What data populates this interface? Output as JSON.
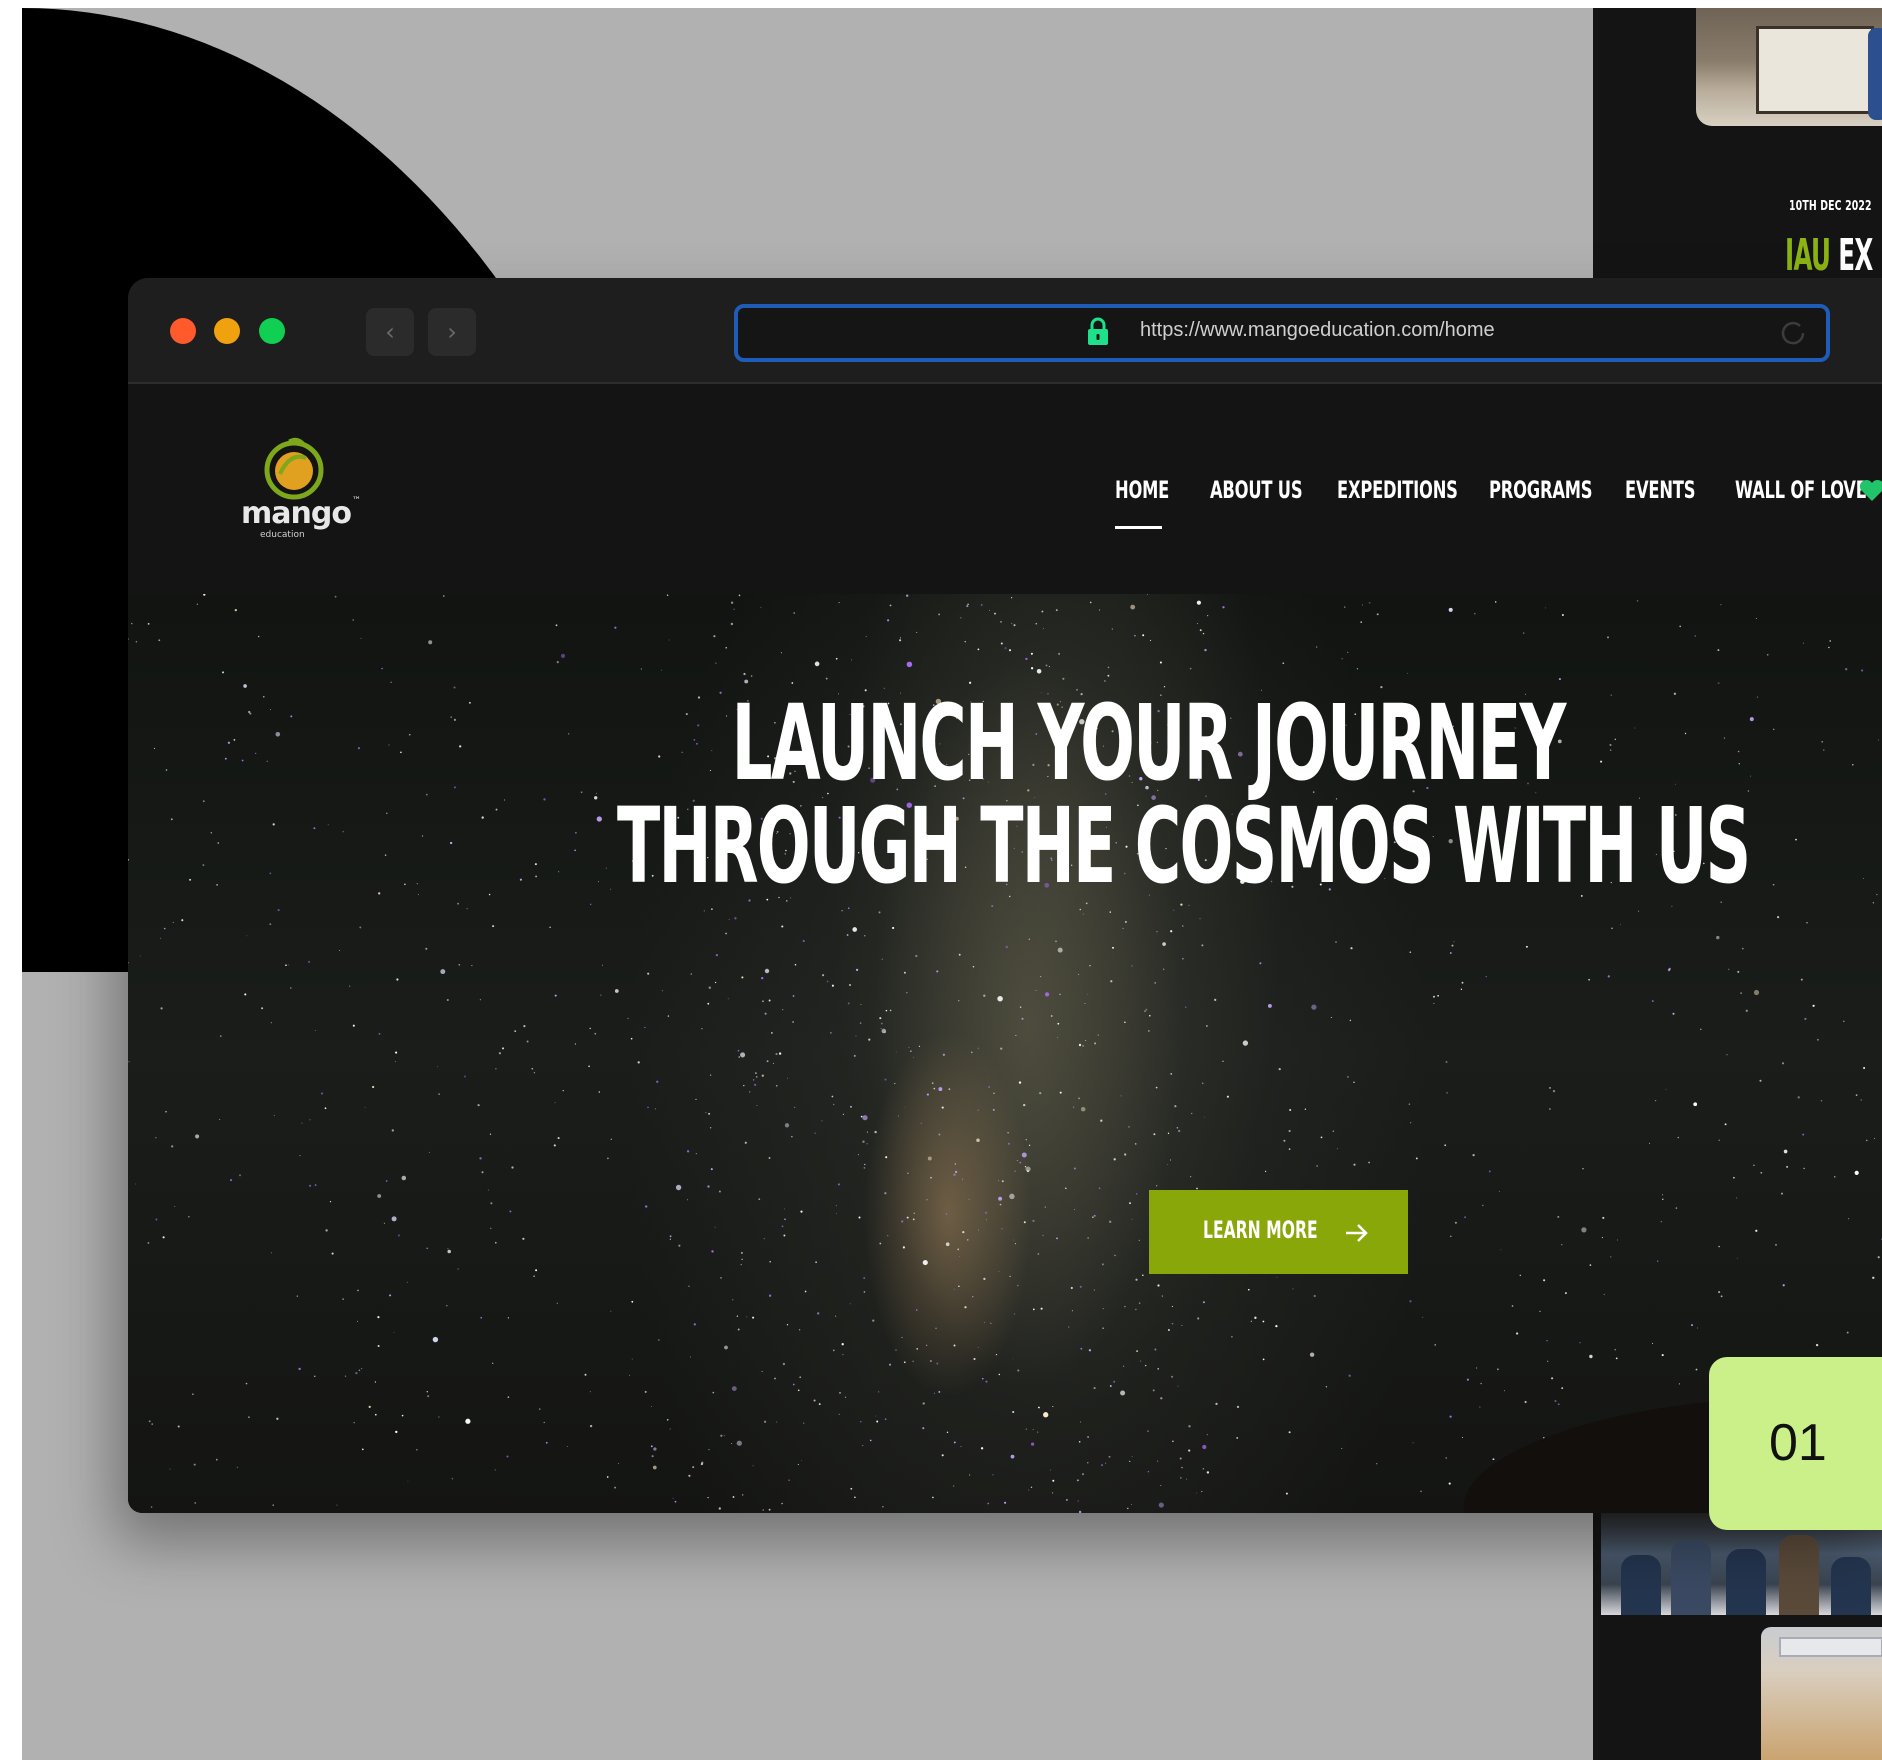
{
  "background": {
    "gray": "#b1b1b1",
    "shape": "#000000"
  },
  "bg_site": {
    "date": "10TH DEC 2022",
    "title_accent": "IAU",
    "title_rest": "EX"
  },
  "browser": {
    "url": "https://www.mangoeducation.com/home",
    "nav_back_icon": "chevron-left-icon",
    "nav_forward_icon": "chevron-right-icon",
    "lock_icon": "lock-icon",
    "reload_icon": "reload-icon"
  },
  "site": {
    "logo": {
      "name": "mango",
      "tagline": "education",
      "tm": "™"
    },
    "nav": [
      "HOME",
      "ABOUT US",
      "EXPEDITIONS",
      "PROGRAMS",
      "EVENTS",
      "WALL OF LOVE"
    ],
    "active_nav": "HOME",
    "hero": {
      "line1": "LAUNCH YOUR JOURNEY",
      "line2": "THROUGH THE COSMOS WITH US",
      "cta": "LEARN MORE"
    },
    "colors": {
      "accent": "#8aa70a",
      "heart": "#22c46a",
      "lock": "#1ee08a"
    }
  },
  "slide_number": "01",
  "slide_badge_color": "#ccf089"
}
